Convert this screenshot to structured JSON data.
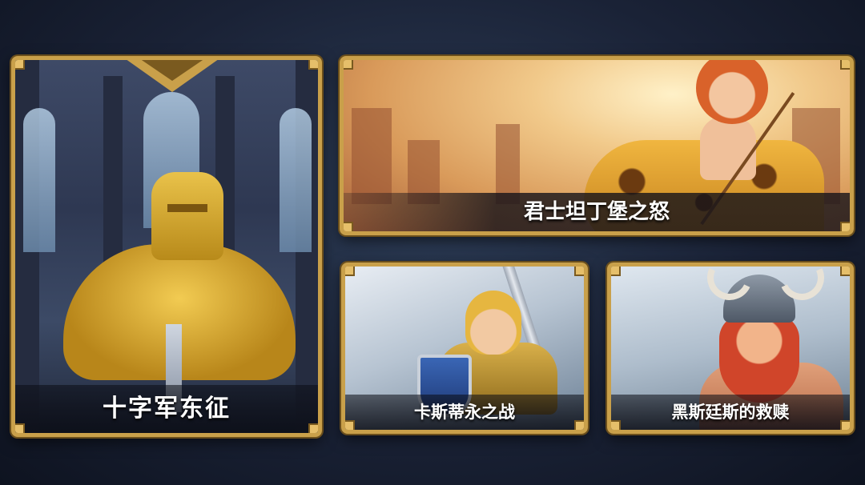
{
  "campaigns": [
    {
      "title": "十字军东征"
    },
    {
      "title": "君士坦丁堡之怒"
    },
    {
      "title": "卡斯蒂永之战"
    },
    {
      "title": "黑斯廷斯的救赎"
    }
  ],
  "colors": {
    "frame_gold": "#c9a04a",
    "banner_text": "#ffffff",
    "background": "#1a2236"
  }
}
